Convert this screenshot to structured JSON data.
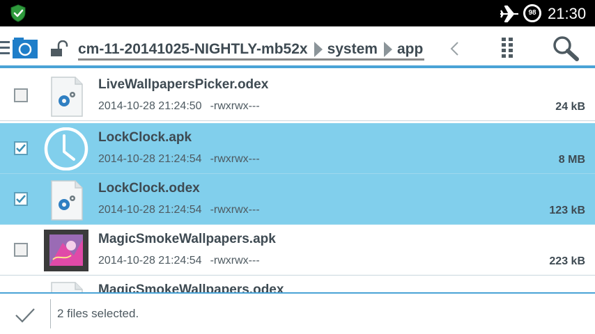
{
  "status_bar": {
    "time": "21:30",
    "battery_level": "98",
    "icons": [
      "shield-check-icon",
      "airplane-icon",
      "battery-icon"
    ]
  },
  "toolbar": {
    "breadcrumb": [
      "cm-11-20141025-NIGHTLY-mb52x",
      "system",
      "app"
    ],
    "icons": [
      "menu-icon",
      "app-logo-icon",
      "unlock-icon",
      "back-chevron-icon",
      "grid-view-icon",
      "search-icon"
    ]
  },
  "files": [
    {
      "name": "LiveWallpapersPicker.odex",
      "date": "2014-10-28 21:24:50",
      "permissions": "-rwxrwx---",
      "size": "24 kB",
      "selected": false,
      "icon": "settings-file-icon"
    },
    {
      "name": "LockClock.apk",
      "date": "2014-10-28 21:24:54",
      "permissions": "-rwxrwx---",
      "size": "8 MB",
      "selected": true,
      "icon": "clock-app-icon"
    },
    {
      "name": "LockClock.odex",
      "date": "2014-10-28 21:24:54",
      "permissions": "-rwxrwx---",
      "size": "123 kB",
      "selected": true,
      "icon": "settings-file-icon"
    },
    {
      "name": "MagicSmokeWallpapers.apk",
      "date": "2014-10-28 21:24:54",
      "permissions": "-rwxrwx---",
      "size": "223 kB",
      "selected": false,
      "icon": "wallpaper-app-icon"
    },
    {
      "name": "MagicSmokeWallpapers.odex",
      "selected": false,
      "icon": "settings-file-icon"
    }
  ],
  "bottom_bar": {
    "selection_text": "2 files selected.",
    "icon": "checkmark-icon"
  },
  "colors": {
    "accent": "#4aa3d6",
    "selected_row": "#81cfec",
    "status_bar": "#000000",
    "shield": "#2e9a3c"
  }
}
